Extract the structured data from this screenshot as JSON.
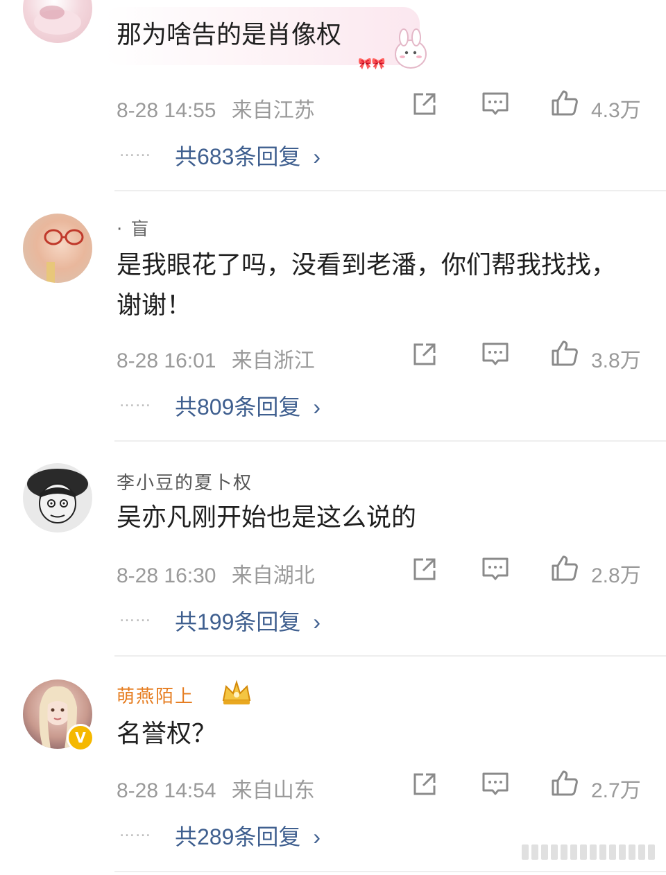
{
  "comments": [
    {
      "username": "",
      "text": "那为啥告的是肖像权",
      "date": "8-28 14:55",
      "location": "来自江苏",
      "likes": "4.3万",
      "dots": "……",
      "replies": "共683条回复"
    },
    {
      "username": "· 盲",
      "text": "是我眼花了吗，没看到老潘，你们帮我找找，谢谢！",
      "date": "8-28 16:01",
      "location": "来自浙江",
      "likes": "3.8万",
      "dots": "……",
      "replies": "共809条回复"
    },
    {
      "username": "李小豆的夏卜权",
      "text": "吴亦凡刚开始也是这么说的",
      "date": "8-28 16:30",
      "location": "来自湖北",
      "likes": "2.8万",
      "dots": "……",
      "replies": "共199条回复"
    },
    {
      "username": "萌燕陌上",
      "text": "名誉权？",
      "date": "8-28 14:54",
      "location": "来自山东",
      "likes": "2.7万",
      "dots": "……",
      "replies": "共289条回复",
      "badge": "V"
    }
  ],
  "icons": {
    "share": "share-icon",
    "comment": "comment-icon",
    "like": "thumbs-up-icon",
    "chevron": "chevron-right-icon"
  },
  "colors": {
    "reply_link": "#3f5f8f",
    "meta_gray": "#9a9a9a",
    "vip_gold": "#f5b800"
  }
}
